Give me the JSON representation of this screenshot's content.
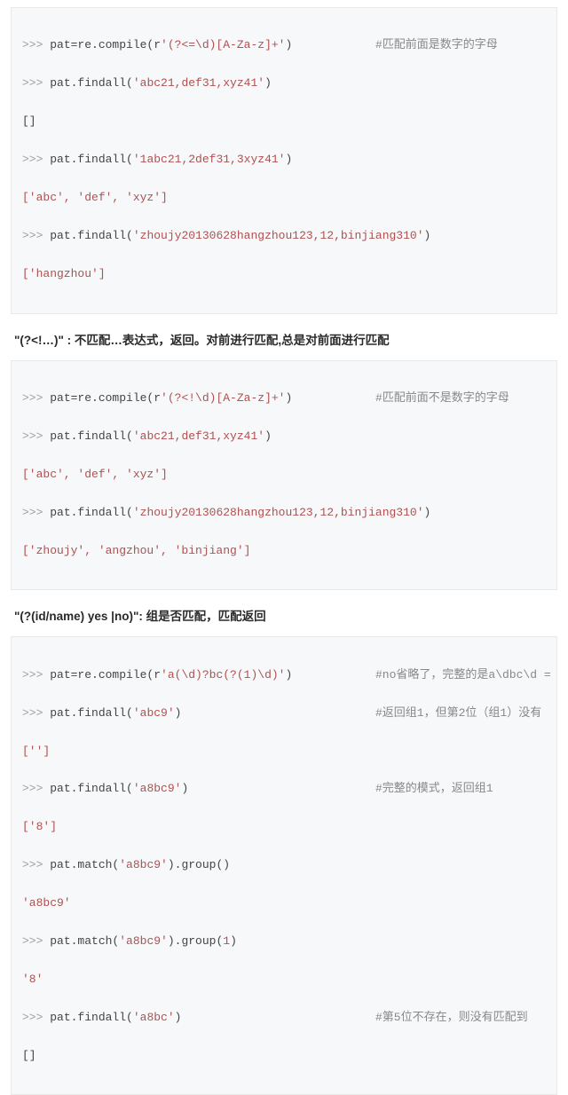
{
  "block1": {
    "l1_prompt": ">>> ",
    "l1_code_a": "pat=re.compile(r",
    "l1_code_b": "'(?<=\\d)[A-Za-z]+'",
    "l1_code_c": ")",
    "l1_comment": "#匹配前面是数字的字母",
    "l2_prompt": ">>> ",
    "l2_code_a": "pat.findall(",
    "l2_code_b": "'abc21,def31,xyz41'",
    "l2_code_c": ")",
    "l3": "[]",
    "l4_prompt": ">>> ",
    "l4_code_a": "pat.findall(",
    "l4_code_b": "'1abc21,2def31,3xyz41'",
    "l4_code_c": ")",
    "l5": "['abc', 'def', 'xyz']",
    "l6_prompt": ">>> ",
    "l6_code_a": "pat.findall(",
    "l6_code_b": "'zhoujy20130628hangzhou123,12,binjiang310'",
    "l6_code_c": ")",
    "l7": "['hangzhou']"
  },
  "heading1": "\"(?<!…)\" : 不匹配…表达式，返回。对前进行匹配,总是对前面进行匹配",
  "block2": {
    "l1_prompt": ">>> ",
    "l1_code_a": "pat=re.compile(r",
    "l1_code_b": "'(?<!\\d)[A-Za-z]+'",
    "l1_code_c": ")",
    "l1_comment": "#匹配前面不是数字的字母",
    "l2_prompt": ">>> ",
    "l2_code_a": "pat.findall(",
    "l2_code_b": "'abc21,def31,xyz41'",
    "l2_code_c": ")",
    "l3": "['abc', 'def', 'xyz']",
    "l4_prompt": ">>> ",
    "l4_code_a": "pat.findall(",
    "l4_code_b": "'zhoujy20130628hangzhou123,12,binjiang310'",
    "l4_code_c": ")",
    "l5": "['zhoujy', 'angzhou', 'binjiang']"
  },
  "heading2": "\"(?(id/name) yes |no)\": 组是否匹配，匹配返回",
  "block3": {
    "l1_prompt": ">>> ",
    "l1_code_a": "pat=re.compile(r",
    "l1_code_b": "'a(\\d)?bc(?(1)\\d)'",
    "l1_code_c": ")",
    "l1_comment": "#no省略了，完整的是a\\dbc\\d =",
    "l2_prompt": ">>> ",
    "l2_code_a": "pat.findall(",
    "l2_code_b": "'abc9'",
    "l2_code_c": ")",
    "l2_comment": "#返回组1，但第2位（组1）没有",
    "l3": "['']",
    "l4_prompt": ">>> ",
    "l4_code_a": "pat.findall(",
    "l4_code_b": "'a8bc9'",
    "l4_code_c": ")",
    "l4_comment": "#完整的模式，返回组1",
    "l5": "['8']",
    "l6_prompt": ">>> ",
    "l6_code_a": "pat.match(",
    "l6_code_b": "'a8bc9'",
    "l6_code_c": ").group()",
    "l7": "'a8bc9'",
    "l8_prompt": ">>> ",
    "l8_code_a": "pat.match(",
    "l8_code_b": "'a8bc9'",
    "l8_code_c": ").group(",
    "l8_code_d": "1",
    "l8_code_e": ")",
    "l9": "'8'",
    "l10_prompt": ">>> ",
    "l10_code_a": "pat.findall(",
    "l10_code_b": "'a8bc'",
    "l10_code_c": ")",
    "l10_comment": "#第5位不存在，则没有匹配到",
    "l11": "[]"
  }
}
